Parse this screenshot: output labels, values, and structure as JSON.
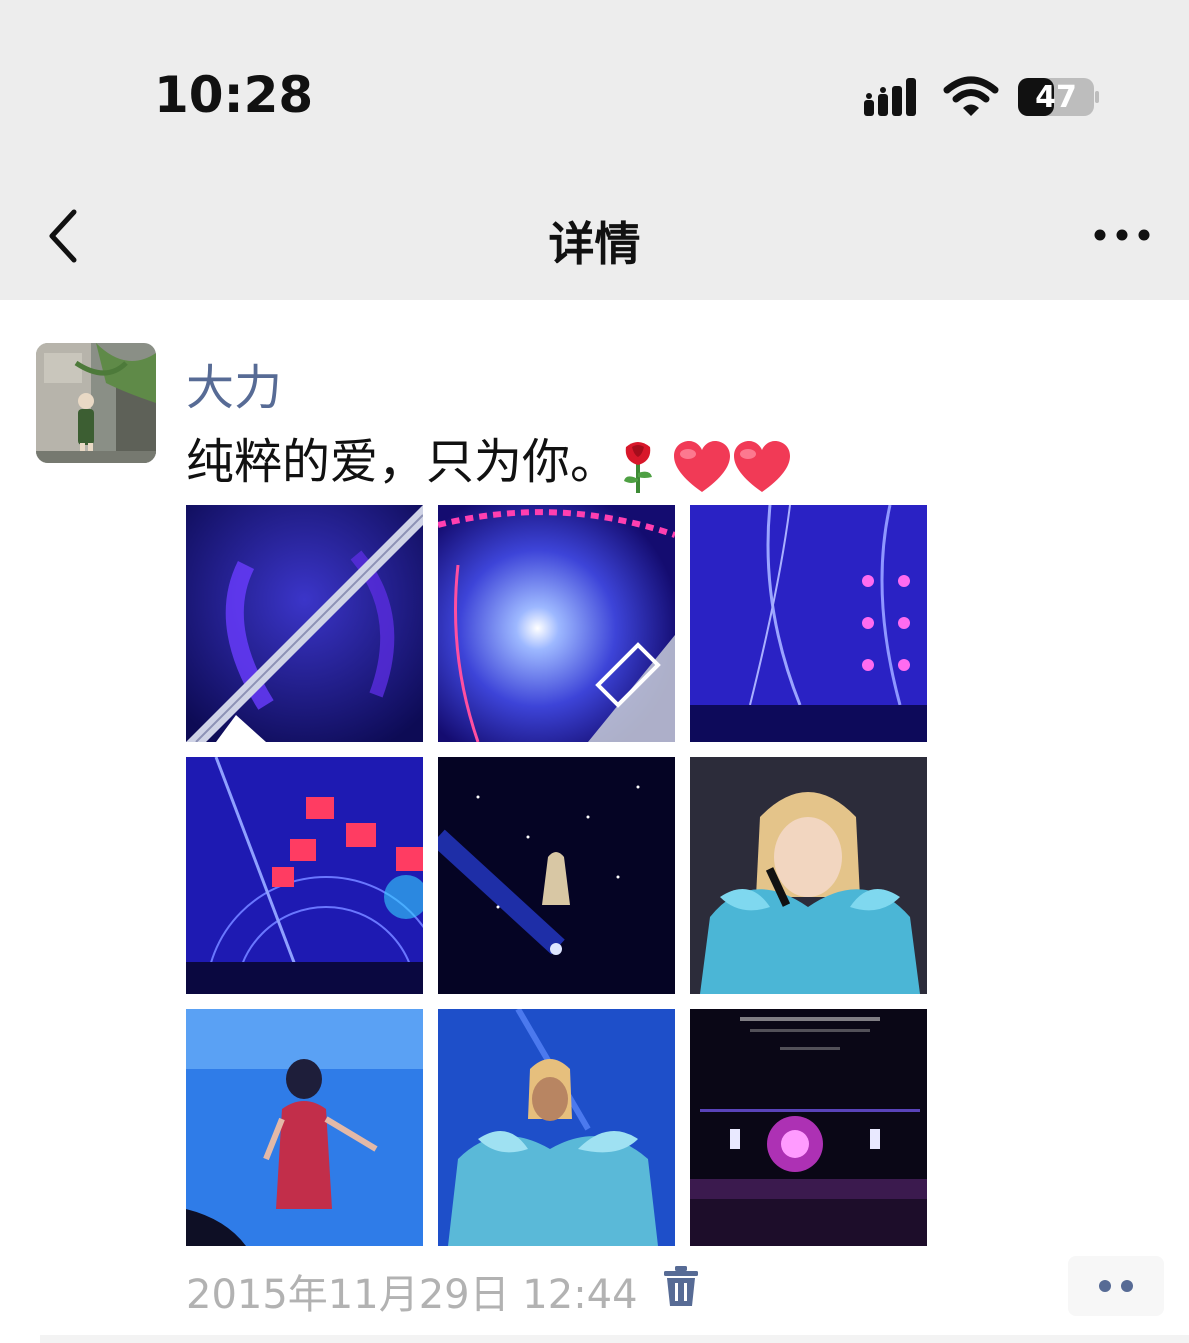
{
  "status_bar": {
    "time": "10:28",
    "battery": "47",
    "battery_level": 0.47
  },
  "nav": {
    "title": "详情",
    "back_icon": "chevron-left-icon",
    "more_icon": "ellipsis-icon"
  },
  "post": {
    "author": "大力",
    "text": "纯粹的爱，只为你。",
    "emojis": [
      "rose-icon",
      "heart-icon",
      "heart-icon"
    ],
    "timestamp": "2015年11月29日 12:44",
    "photos": [
      {
        "name": "photo-1"
      },
      {
        "name": "photo-2"
      },
      {
        "name": "photo-3"
      },
      {
        "name": "photo-4"
      },
      {
        "name": "photo-5"
      },
      {
        "name": "photo-6"
      },
      {
        "name": "photo-7"
      },
      {
        "name": "photo-8"
      },
      {
        "name": "photo-9"
      }
    ]
  },
  "colors": {
    "author_link": "#576b95",
    "timestamp": "#b2b2b2",
    "nav_bg": "#ededed",
    "delete_icon": "#576b95"
  }
}
